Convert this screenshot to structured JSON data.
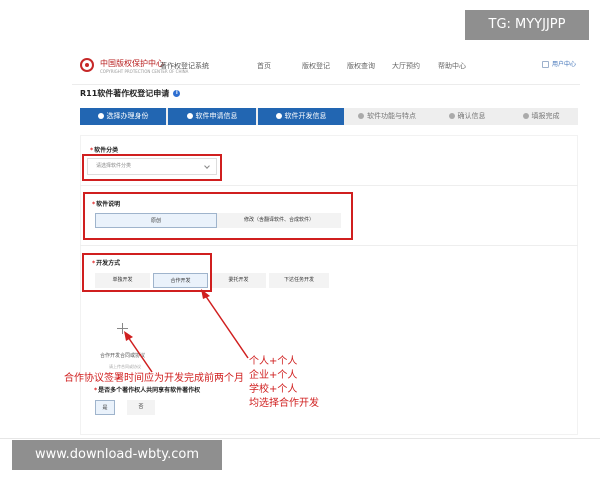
{
  "watermarks": {
    "top": "TG: MYYJJPP",
    "bottom": "www.download-wbty.com"
  },
  "header": {
    "org_name": "中国版权保护中心",
    "org_sub": "COPYRIGHT PROTECTION CENTER OF CHINA",
    "system_name": "著作权登记系统",
    "nav": [
      "首页",
      "版权登记",
      "版权查询",
      "大厅预约",
      "帮助中心"
    ],
    "user_label": "用户中心"
  },
  "form": {
    "title": "R11软件著作权登记申请",
    "info_icon_glyph": "i"
  },
  "steps": [
    {
      "label": "选择办理身份",
      "state": "active"
    },
    {
      "label": "软件申请信息",
      "state": "active"
    },
    {
      "label": "软件开发信息",
      "state": "active"
    },
    {
      "label": "软件功能与特点",
      "state": "idle"
    },
    {
      "label": "确认信息",
      "state": "idle"
    },
    {
      "label": "填报完成",
      "state": "idle"
    }
  ],
  "sections": {
    "category": {
      "label": "软件分类",
      "placeholder": "请选择软件分类"
    },
    "description": {
      "label": "软件说明",
      "options": [
        "原创",
        "修改（含翻译软件、合成软件）"
      ],
      "selected": "原创"
    },
    "dev_method": {
      "label": "开发方式",
      "options": [
        "单独开发",
        "合作开发",
        "委托开发",
        "下达任务开发"
      ],
      "selected": "合作开发",
      "upload_label": "合作开发合同或协议",
      "upload_hint": "请上传合同或协议"
    },
    "shared": {
      "label": "是否多个著作权人共同享有软件著作权",
      "options": [
        "是",
        "否"
      ],
      "selected": "是"
    }
  },
  "annotations": {
    "left": "合作协议签署时间应为开发完成前两个月",
    "right": [
      "个人+个人",
      "企业+个人",
      "学校+个人",
      "均选择合作开发"
    ]
  },
  "colors": {
    "primary": "#2266b2",
    "annotation_red": "#d01f1f",
    "step_idle_bg": "#eeeeee"
  }
}
